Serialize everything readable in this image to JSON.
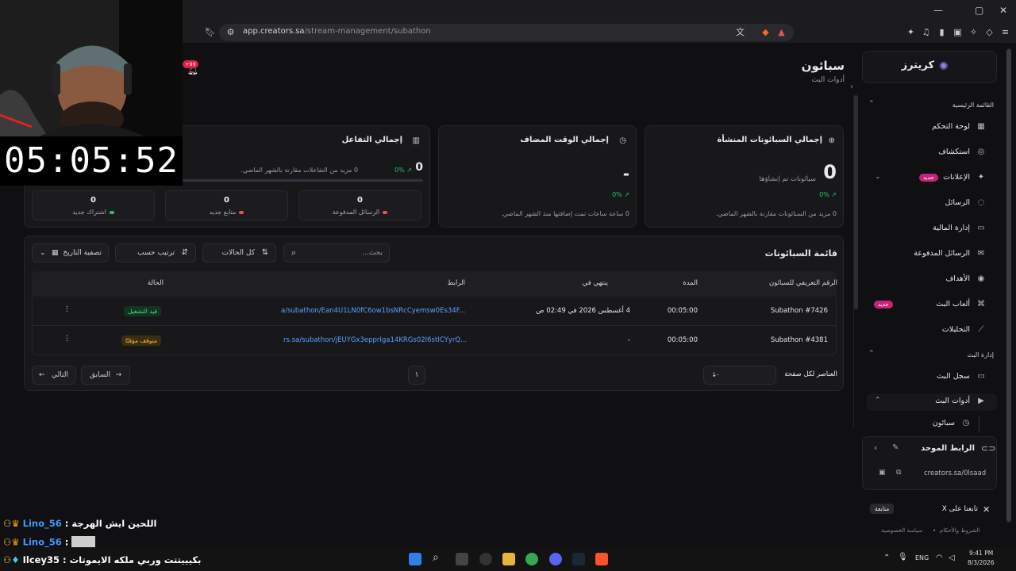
{
  "browser": {
    "url": "app.creators.sa/stream-management/subathon",
    "url_base": "app.creators.sa",
    "url_path": "/stream-management/subathon",
    "notif_count": "+99"
  },
  "header": {
    "title": "سبائون",
    "subtitle": "أدوات البث"
  },
  "stats": {
    "created": {
      "title": "إجمالي السبائونات المنشأة",
      "value": "0",
      "unit": "سبائونات تم إنشاؤها",
      "change": "0% ↗",
      "note": "0 مزيد من السبائونات مقارنة بالشهر الماضي."
    },
    "time": {
      "title": "إجمالي الوقت المضاف",
      "value": "-",
      "change": "0% ↗",
      "note": "0 ساعة ساعات تمت إضافتها منذ الشهر الماضي."
    },
    "engagement": {
      "title": "إجمالي التفاعل",
      "value": "0",
      "change": "0% ↗",
      "note": "0 مزيد من التفاعلات مقارنة بالشهر الماضي.",
      "progress": 0,
      "boxes": [
        {
          "value": "0",
          "label": "الرسائل المدفوعة",
          "color": "#e2574c"
        },
        {
          "value": "0",
          "label": "متابع جديد",
          "color": "#e2574c"
        },
        {
          "value": "0",
          "label": "اشتراك جديد",
          "color": "#22c55e"
        }
      ]
    }
  },
  "list": {
    "title": "قائمة السبائونات",
    "search_placeholder": "بحث...",
    "filter_status": "كل الحالات",
    "sort": "ترتيب حسب",
    "date_filter": "تصفية التاريخ",
    "columns": [
      "الرقم التعريفي للسبائون",
      "المدة",
      "ينتهي في",
      "الرابط",
      "الحالة"
    ],
    "rows": [
      {
        "id": "Subathon #7426",
        "duration": "00:05:00",
        "ends": "4 أغسطس 2026 في 02:49 ص",
        "link": "a/subathon/Ean4U1LN0fC6ow1bsNRcCyemsw0Es34F...",
        "status": "قيد التشغيل",
        "status_type": "run"
      },
      {
        "id": "Subathon #4381",
        "duration": "00:05:00",
        "ends": "-",
        "link": "rs.sa/subathon/jEUYGx3epprIga14KRGs02I6stICYyrQ...",
        "status": "متوقف مؤقتًا",
        "status_type": "pause"
      }
    ],
    "per_page_label": "العناصر لكل صفحة",
    "per_page": "١٠",
    "page": "١",
    "prev": "السابق",
    "next": "التالي"
  },
  "sidebar": {
    "brand": "كريترز",
    "section_main": "القائمة الرئيسية",
    "items": [
      {
        "label": "لوحة التحكم",
        "icon": "dashboard-icon"
      },
      {
        "label": "استكشاف",
        "icon": "compass-icon"
      },
      {
        "label": "الإعلانات",
        "icon": "megaphone-icon",
        "badge": "جديد"
      },
      {
        "label": "الرسائل",
        "icon": "chat-icon"
      },
      {
        "label": "إدارة المالية",
        "icon": "wallet-icon"
      },
      {
        "label": "الرسائل المدفوعة",
        "icon": "paid-message-icon"
      },
      {
        "label": "الأهداف",
        "icon": "target-icon"
      },
      {
        "label": "ألعاب البث",
        "icon": "gamepad-icon",
        "badge": "جديد"
      },
      {
        "label": "التحليلات",
        "icon": "analytics-icon"
      }
    ],
    "section_stream": "إدارة البث",
    "stream_items": [
      {
        "label": "سجل البث",
        "icon": "video-icon"
      },
      {
        "label": "أدوات البث",
        "icon": "tools-icon"
      },
      {
        "label": "سبائون",
        "icon": "clock-icon"
      }
    ],
    "unified_link_title": "الرابط الموحد",
    "unified_link": "creators.sa/0lsaad",
    "follow_x": "تابعنا على X",
    "follow_btn": "متابعة",
    "terms": "الشروط والأحكام",
    "privacy": "سياسة الخصوصية"
  },
  "overlay": {
    "timer": "05:05:52",
    "chat": [
      {
        "name": "Lino_56",
        "message": "اللحين ايش الهرجة :"
      },
      {
        "name": "Lino_56",
        "message": ":"
      },
      {
        "name": "Ilcey35",
        "message": "بكيييتتت وربي ملكه الايموتات :"
      }
    ]
  },
  "taskbar": {
    "lang": "ENG",
    "time": "9:41 PM",
    "date": "8/3/2026"
  }
}
